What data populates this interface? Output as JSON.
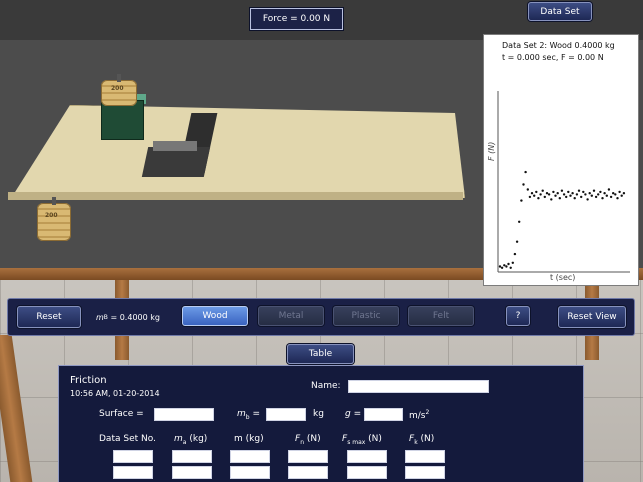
{
  "force_readout": "Force = 0.00 N",
  "dataset_button": "Data Set",
  "graph": {
    "title": "Data Set 2: Wood 0.4000 kg",
    "subtitle": "t = 0.000 sec,  F = 0.00 N",
    "ylabel": "F (N)",
    "xlabel": "t (sec)"
  },
  "chart_data": {
    "type": "scatter",
    "title": "Data Set 2: Wood 0.4000 kg",
    "xlabel": "t (sec)",
    "ylabel": "F (N)",
    "x": [
      0.0,
      0.02,
      0.04,
      0.06,
      0.08,
      0.1,
      0.12,
      0.14,
      0.16,
      0.18,
      0.2,
      0.22,
      0.24,
      0.26,
      0.28,
      0.3,
      0.32,
      0.34,
      0.36,
      0.38,
      0.4,
      0.42,
      0.44,
      0.46,
      0.48,
      0.5,
      0.52,
      0.54,
      0.56,
      0.58,
      0.6,
      0.62,
      0.64,
      0.66,
      0.68,
      0.7,
      0.72,
      0.74,
      0.76,
      0.78,
      0.8,
      0.82,
      0.84,
      0.86,
      0.88,
      0.9,
      0.92,
      0.94,
      0.96,
      0.98,
      1.0,
      1.02,
      1.04,
      1.06,
      1.08,
      1.1,
      1.12,
      1.14,
      1.16
    ],
    "y": [
      0.02,
      0.01,
      0.03,
      0.02,
      0.04,
      0.01,
      0.05,
      0.12,
      0.22,
      0.38,
      0.55,
      0.68,
      0.78,
      0.64,
      0.58,
      0.61,
      0.59,
      0.62,
      0.57,
      0.6,
      0.63,
      0.58,
      0.61,
      0.6,
      0.56,
      0.62,
      0.59,
      0.61,
      0.57,
      0.63,
      0.6,
      0.58,
      0.62,
      0.59,
      0.61,
      0.57,
      0.6,
      0.63,
      0.58,
      0.62,
      0.6,
      0.56,
      0.61,
      0.59,
      0.63,
      0.58,
      0.6,
      0.62,
      0.57,
      0.61,
      0.59,
      0.64,
      0.58,
      0.61,
      0.6,
      0.57,
      0.62,
      0.59,
      0.61
    ]
  },
  "weights": {
    "on_block": "200",
    "on_floor": "200"
  },
  "controls": {
    "reset": "Reset",
    "mass_label": "m",
    "mass_sub": "B",
    "mass_value": "= 0.4000 kg",
    "surfaces": [
      "Wood",
      "Metal",
      "Plastic",
      "Felt"
    ],
    "active_surface": "Wood",
    "help": "?",
    "reset_view": "Reset View"
  },
  "table_tab": "Table",
  "table": {
    "title": "Friction",
    "timestamp": "10:56 AM, 01-20-2014",
    "name_label": "Name:",
    "surface_label": "Surface =",
    "mb_label": "m",
    "mb_sub": "b",
    "mb_eq": "=",
    "mb_unit": "kg",
    "g_label": "g =",
    "g_unit": "m/s",
    "g_exp": "2",
    "col_dataset": "Data Set No.",
    "col_ma": "m",
    "col_ma_sub": "a",
    "col_ma_unit": "(kg)",
    "col_m": "m (kg)",
    "col_fn": "F",
    "col_fn_sub": "n",
    "col_fn_unit": "(N)",
    "col_fsmax": "F",
    "col_fsmax_sub": "s max",
    "col_fsmax_unit": "(N)",
    "col_fk": "F",
    "col_fk_sub": "k",
    "col_fk_unit": "(N)"
  }
}
